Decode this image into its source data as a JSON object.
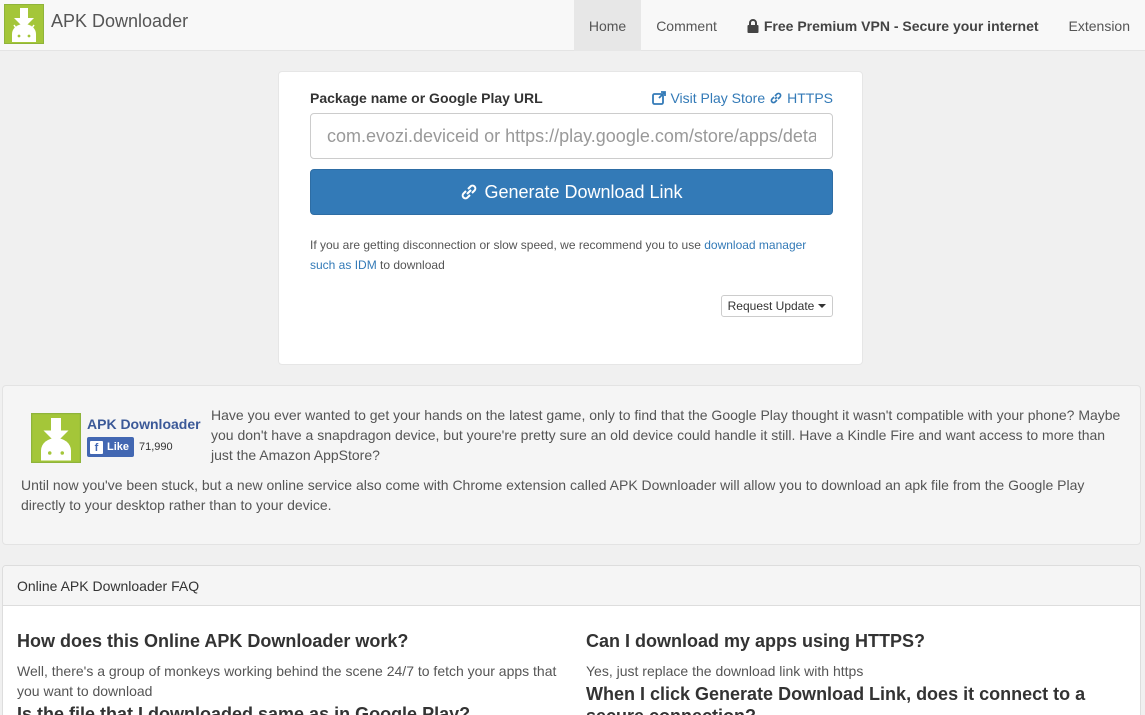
{
  "navbar": {
    "brand": "APK Downloader",
    "items": [
      {
        "label": "Home",
        "active": true
      },
      {
        "label": "Comment"
      },
      {
        "label": "Free Premium VPN - Secure your internet",
        "icon": "lock-icon"
      },
      {
        "label": "Extension"
      }
    ]
  },
  "form": {
    "label": "Package name or Google Play URL",
    "visit_store": "Visit Play Store",
    "https": "HTTPS",
    "placeholder": "com.evozi.deviceid or https://play.google.com/store/apps/details?id=com.evozi.deviceid",
    "generate_label": "Generate Download Link",
    "note_prefix": "If you are getting disconnection or slow speed, we recommend you to use ",
    "note_link": "download manager such as IDM",
    "note_suffix": " to download",
    "request_update": "Request Update"
  },
  "about": {
    "name": "APK Downloader",
    "like": "Like",
    "like_count": "71,990",
    "p1": "Have you ever wanted to get your hands on the latest game, only to find that the Google Play thought it wasn't compatible with your phone? Maybe you don't have a snapdragon device, but youre're pretty sure an old device could handle it still. Have a Kindle Fire and want access to more than just the Amazon AppStore?",
    "p2": "Until now you've been stuck, but a new online service also come with Chrome extension called APK Downloader will allow you to download an apk file from the Google Play directly to your desktop rather than to your device."
  },
  "faq": {
    "title": "Online APK Downloader FAQ",
    "left": [
      {
        "q": "How does this Online APK Downloader work?",
        "a": "Well, there's a group of monkeys working behind the scene 24/7 to fetch your apps that you want to download"
      },
      {
        "q": "Is the file that I downloaded same as in Google Play?",
        "a": ""
      }
    ],
    "right": [
      {
        "q": "Can I download my apps using HTTPS?",
        "a": "Yes, just replace the download link with https"
      },
      {
        "q": "When I click Generate Download Link, does it connect to a secure connection?",
        "a": ""
      }
    ]
  },
  "colors": {
    "primary": "#337ab7",
    "android_green": "#a4c639",
    "facebook": "#4267b2"
  }
}
